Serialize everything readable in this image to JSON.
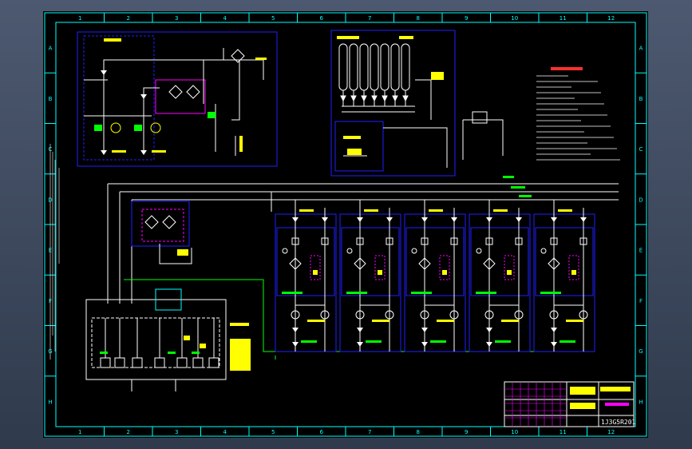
{
  "colors": {
    "frame": "#00ffff",
    "process_line": "#ffffff",
    "subsystem_box": "#2020ff",
    "label": "#ffff00",
    "valve": "#ffffff",
    "signal": "#00ff00",
    "accent": "#ff00ff",
    "instrument": "#ff3030"
  },
  "border": {
    "columns": [
      "1",
      "2",
      "3",
      "4",
      "5",
      "6",
      "7",
      "8",
      "9",
      "10",
      "11",
      "12"
    ],
    "rows": [
      "A",
      "B",
      "C",
      "D",
      "E",
      "F",
      "G",
      "H"
    ]
  },
  "title_block": {
    "drawing_number": "1J3G5R201"
  },
  "icons": [
    "valve-icon",
    "filter-icon",
    "pump-icon",
    "check-valve-icon",
    "gauge-icon",
    "accumulator-icon",
    "flow-meter-icon"
  ]
}
